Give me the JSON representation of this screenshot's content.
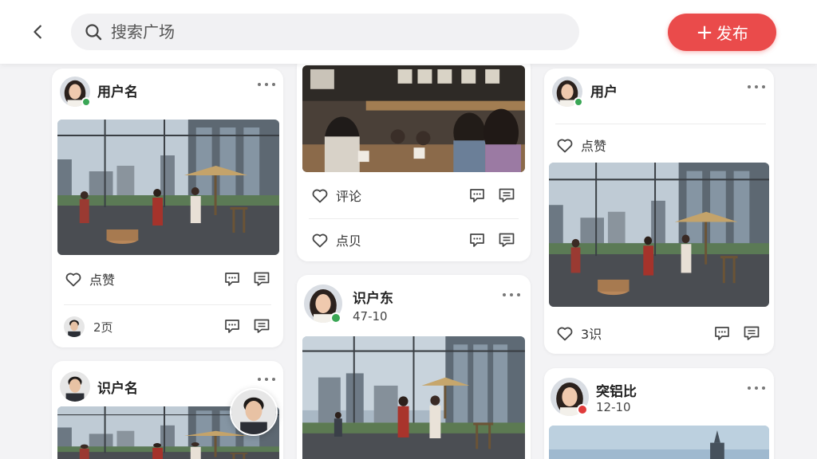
{
  "header": {
    "search_placeholder": "搜索广场",
    "publish_label": "发布"
  },
  "cards": {
    "c1": {
      "username": "用户名",
      "like": "点赞",
      "commenter": "2页"
    },
    "c2": {
      "comment": "评论",
      "like": "点贝"
    },
    "c3": {
      "username": "用户",
      "like": "点赞",
      "count": "3识"
    },
    "c4": {
      "username": "识户名"
    },
    "c5": {
      "username": "识户东",
      "date": "47-10"
    },
    "c6": {
      "username": "突铝比",
      "date": "12-10"
    }
  },
  "icons": {
    "back": "chevron-left-icon",
    "search": "search-icon",
    "plus": "plus-icon",
    "like": "heart-icon",
    "comment": "comment-bubble-icon",
    "message": "message-square-icon",
    "more": "more-dots-icon"
  },
  "colors": {
    "accent": "#ea4b4b",
    "online": "#3aa655",
    "busy": "#e03b3b"
  }
}
